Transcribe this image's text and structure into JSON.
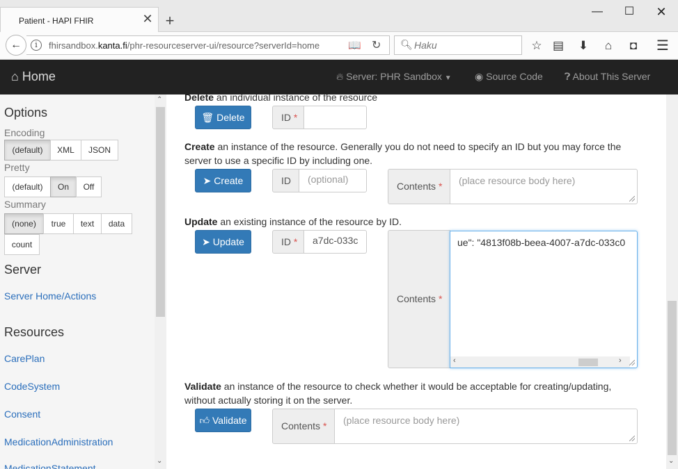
{
  "browser": {
    "tab_title": "Patient - HAPI FHIR",
    "url_prefix": "fhirsandbox.",
    "url_domain": "kanta.fi",
    "url_suffix": "/phr-resourceserver-ui/resource?serverId=home",
    "search_placeholder": "Haku"
  },
  "appnav": {
    "home": "Home",
    "server": "Server: PHR Sandbox",
    "source_code": "Source Code",
    "about": "About This Server"
  },
  "sidebar": {
    "options_heading": "Options",
    "encoding_label": "Encoding",
    "encoding_options": [
      "(default)",
      "XML",
      "JSON"
    ],
    "encoding_selected": "(default)",
    "pretty_label": "Pretty",
    "pretty_options": [
      "(default)",
      "On",
      "Off"
    ],
    "pretty_selected": "On",
    "summary_label": "Summary",
    "summary_options": [
      "(none)",
      "true",
      "text",
      "data",
      "count"
    ],
    "summary_selected": "(none)",
    "server_heading": "Server",
    "server_link": "Server Home/Actions",
    "resources_heading": "Resources",
    "resources": [
      "CarePlan",
      "CodeSystem",
      "Consent",
      "MedicationAdministration",
      "MedicationStatement"
    ]
  },
  "main": {
    "delete": {
      "desc_bold": "Delete",
      "desc_rest": " an individual instance of the resource",
      "button": "Delete",
      "id_label": "ID",
      "id_value": ""
    },
    "create": {
      "desc_bold": "Create",
      "desc_rest": " an instance of the resource. Generally you do not need to specify an ID but you may force the server to use a specific ID by including one.",
      "button": "Create",
      "id_label": "ID",
      "id_placeholder": "(optional)",
      "contents_label": "Contents",
      "contents_placeholder": "(place resource body here)"
    },
    "update": {
      "desc_bold": "Update",
      "desc_rest": " an existing instance of the resource by ID.",
      "button": "Update",
      "id_label": "ID",
      "id_value": "a7dc-033c",
      "contents_label": "Contents",
      "contents_value": "ue\": \"4813f08b-beea-4007-a7dc-033c0"
    },
    "validate": {
      "desc_bold": "Validate",
      "desc_rest": " an instance of the resource to check whether it would be acceptable for creating/updating, without actually storing it on the server.",
      "button": "Validate",
      "contents_label": "Contents",
      "contents_placeholder": "(place resource body here)"
    },
    "required_marker": "*"
  },
  "colors": {
    "primary": "#337ab7",
    "nav_bg": "#222222",
    "link": "#2a6ebb",
    "required": "#d9534f"
  }
}
